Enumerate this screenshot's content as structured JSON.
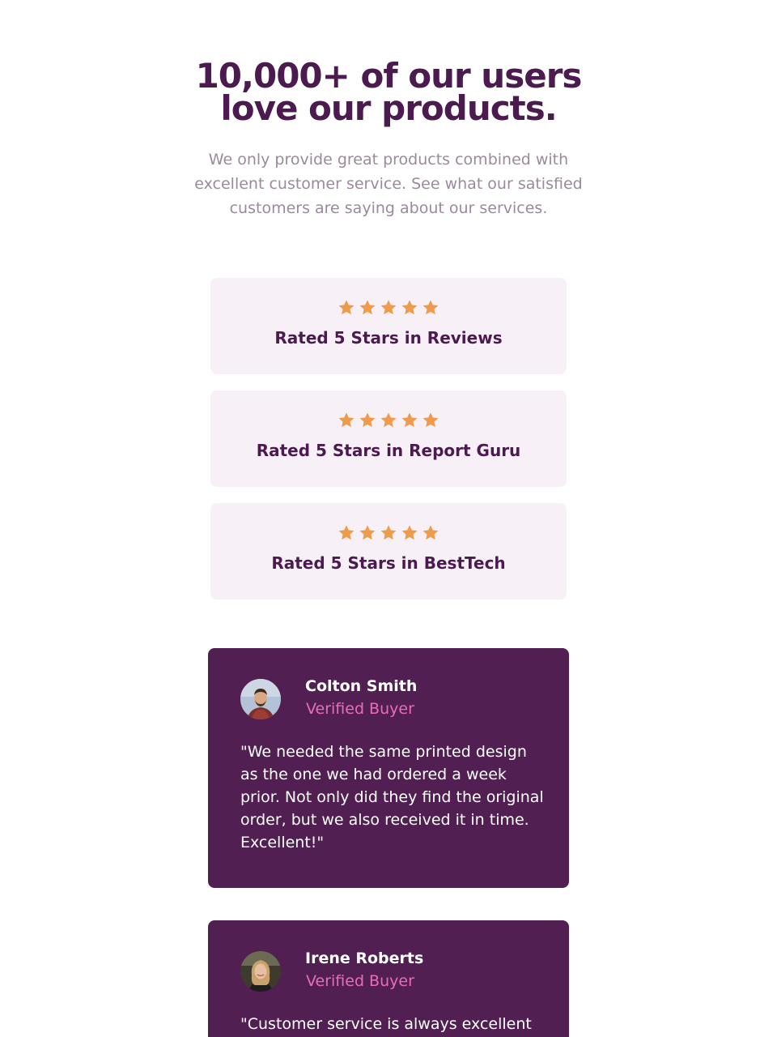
{
  "header": {
    "title": "10,000+ of our users love our products.",
    "intro": "We only provide great products combined with excellent customer service. See what our satisfied customers are saying about our services."
  },
  "ratings": [
    {
      "stars": 5,
      "label": "Rated 5 Stars in Reviews"
    },
    {
      "stars": 5,
      "label": "Rated 5 Stars in Report Guru"
    },
    {
      "stars": 5,
      "label": "Rated 5 Stars in BestTech"
    }
  ],
  "testimonials": [
    {
      "name": "Colton Smith",
      "role": "Verified Buyer",
      "quote": "\"We needed the same printed design as the one we had ordered a week prior. Not only did they find the original order, but we also received it in time. Excellent!\""
    },
    {
      "name": "Irene Roberts",
      "role": "Verified Buyer",
      "quote": "\"Customer service is always excellent"
    }
  ],
  "colors": {
    "heading": "#4b1a4f",
    "star": "#ee9b4c",
    "card_background": "#f7f1f7",
    "testimonial_background": "#521f52",
    "accent_pink": "#e86db9"
  },
  "icons": {
    "star": "star-icon"
  }
}
